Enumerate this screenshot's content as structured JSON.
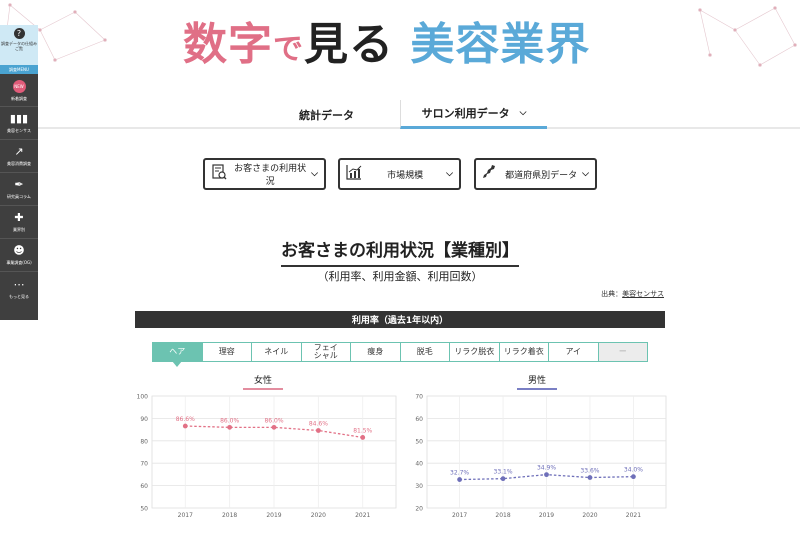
{
  "header": {
    "title_part1": "数字",
    "title_part2": "で",
    "title_part3": "見る",
    "title_part4": "美容業界"
  },
  "sidebar": {
    "top_label": "調査データの仕組みご覧",
    "menu_label": "調査MENU",
    "new_badge": "NEW",
    "items": [
      {
        "label": "新着調査",
        "icon": "new-badge-icon"
      },
      {
        "label": "美容センサス",
        "icon": "bar-chart-icon"
      },
      {
        "label": "美容消費調査",
        "icon": "trend-up-icon"
      },
      {
        "label": "研究員コラム",
        "icon": "pen-icon"
      },
      {
        "label": "業界別",
        "icon": "tags-icon"
      },
      {
        "label": "事業調査(OG)",
        "icon": "people-icon"
      },
      {
        "label": "もっと見る",
        "icon": "more-icon"
      }
    ]
  },
  "nav": {
    "tab1": "統計データ",
    "tab2": "サロン利用データ",
    "tab2_chevron": "⌄"
  },
  "dropdowns": [
    {
      "label": "お客さまの利用状況",
      "icon": "document-search-icon"
    },
    {
      "label": "市場規模",
      "icon": "line-chart-icon"
    },
    {
      "label": "都道府県別データ",
      "icon": "map-icon"
    }
  ],
  "section": {
    "title": "お客さまの利用状況【業種別】",
    "subtitle": "（利用率、利用金額、利用回数）",
    "source_prefix": "出典：",
    "source_link": "美容センサス",
    "bar_title": "利用率（過去1年以内）"
  },
  "categories": [
    "ヘア",
    "理容",
    "ネイル",
    "フェイ\nシャル",
    "痩身",
    "脱毛",
    "リラク脱衣",
    "リラク着衣",
    "アイ",
    "ー"
  ],
  "active_category": 0,
  "colors": {
    "female": "#e27186",
    "male": "#6e6fb9",
    "accent": "#6cc3b1"
  },
  "chart_data": [
    {
      "type": "line",
      "title": "女性",
      "x": [
        "2017",
        "2018",
        "2019",
        "2020",
        "2021"
      ],
      "series": [
        {
          "values": [
            86.6,
            86.0,
            86.0,
            84.6,
            81.5
          ],
          "labels": [
            "86.6%",
            "86.0%",
            "86.0%",
            "84.6%",
            "81.5%"
          ]
        }
      ],
      "ylim": [
        50,
        100
      ],
      "yticks": [
        "100",
        "90",
        "80",
        "70",
        "60",
        "50"
      ],
      "grid": true
    },
    {
      "type": "line",
      "title": "男性",
      "x": [
        "2017",
        "2018",
        "2019",
        "2020",
        "2021"
      ],
      "series": [
        {
          "values": [
            32.7,
            33.1,
            34.9,
            33.6,
            34.0
          ],
          "labels": [
            "32.7%",
            "33.1%",
            "34.9%",
            "33.6%",
            "34.0%"
          ]
        }
      ],
      "ylim": [
        20,
        70
      ],
      "yticks": [
        "70",
        "60",
        "50",
        "40",
        "30",
        "20"
      ],
      "grid": true
    }
  ]
}
